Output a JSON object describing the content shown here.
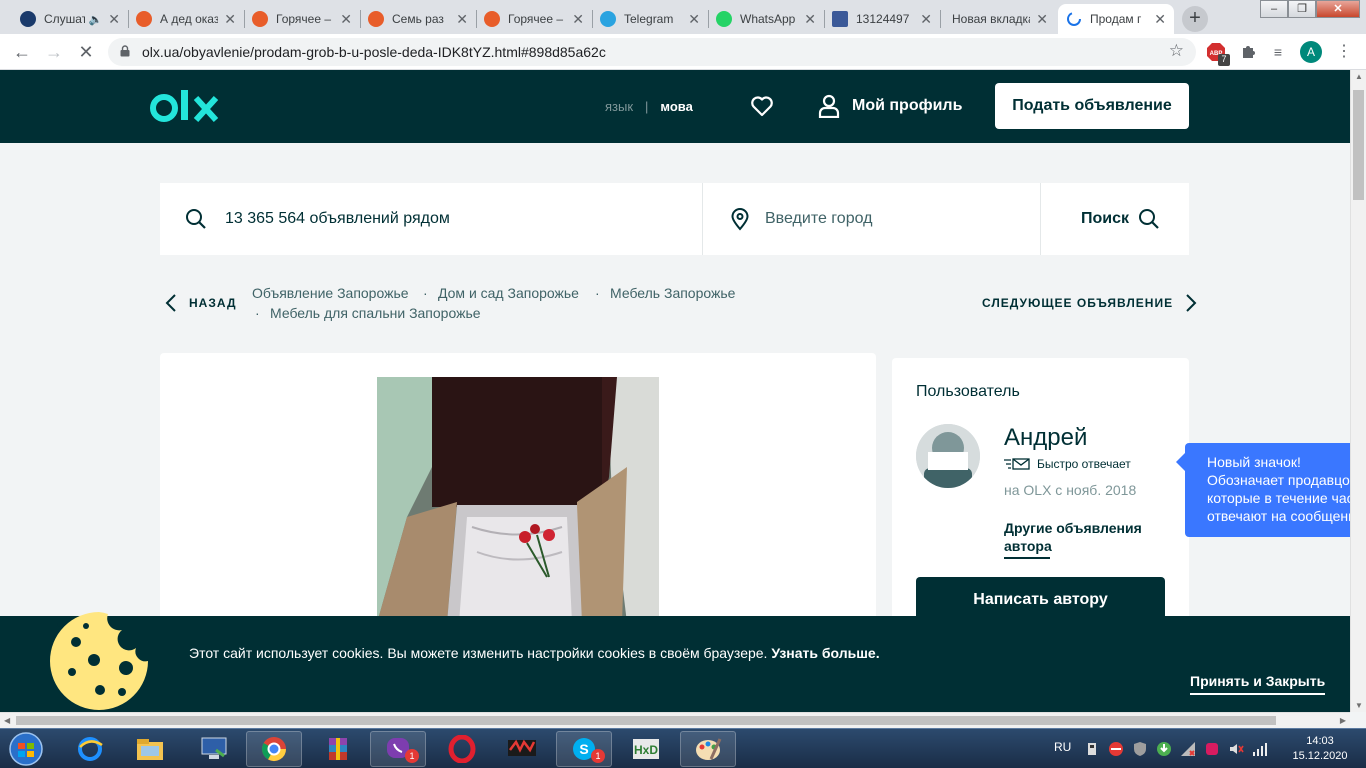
{
  "browser": {
    "tabs": [
      {
        "title": "Слушать",
        "favicon_color": "#1a3a6b",
        "audio": true
      },
      {
        "title": "А дед оказ",
        "favicon_color": "#e85d2a"
      },
      {
        "title": "Горячее – ",
        "favicon_color": "#e85d2a"
      },
      {
        "title": "Семь раз",
        "favicon_color": "#e85d2a"
      },
      {
        "title": "Горячее – ",
        "favicon_color": "#e85d2a"
      },
      {
        "title": "Telegram",
        "favicon_color": "#2aa3e0"
      },
      {
        "title": "WhatsApp",
        "favicon_color": "#25d366"
      },
      {
        "title": "13124497",
        "favicon_color": "#3b5998"
      },
      {
        "title": "Новая вкладка",
        "favicon_color": ""
      },
      {
        "title": "Продам г",
        "favicon_color": "",
        "active": true,
        "loading": true
      }
    ],
    "new_tab_label": "+",
    "url": "olx.ua/obyavlenie/prodam-grob-b-u-posle-deda-IDK8tYZ.html#898d85a62c",
    "abp_count": "7",
    "account_initial": "A"
  },
  "header": {
    "lang_ru": "язык",
    "lang_sep": "|",
    "lang_ua": "мова",
    "profile_label": "Мой профиль",
    "post_ad_label": "Подать объявление"
  },
  "search": {
    "query_placeholder": "13 365 564 объявлений рядом",
    "city_placeholder": "Введите город",
    "button_label": "Поиск"
  },
  "breadcrumb": {
    "back_label": "НАЗАД",
    "items": [
      "Объявление Запорожье",
      "Дом и сад Запорожье",
      "Мебель Запорожье",
      "Мебель для спальни Запорожье"
    ],
    "next_label": "СЛЕДУЮЩЕЕ ОБЪЯВЛЕНИЕ"
  },
  "seller": {
    "section_title": "Пользователь",
    "name": "Андрей",
    "fast_reply": "Быстро отвечает",
    "since": "на OLX с нояб. 2018",
    "other_ads": "Другие объявления автора",
    "write_button": "Написать автору"
  },
  "tooltip": {
    "line1": "Новый значок!",
    "line2": "Обозначает продавцов,",
    "line3": "которые в течение часа",
    "line4": "отвечают на сообщения"
  },
  "cookie": {
    "text": "Этот сайт использует cookies. Вы можете изменить настройки cookies в своём браузере.",
    "more": "Узнать больше.",
    "accept": "Принять и Закрыть"
  },
  "taskbar": {
    "lang": "RU",
    "time": "14:03",
    "date": "15.12.2020",
    "viber_badge": "1",
    "skype_badge": "1"
  },
  "colors": {
    "olx_dark": "#002f34",
    "olx_teal": "#23e5db",
    "tooltip_blue": "#3a77ff"
  }
}
